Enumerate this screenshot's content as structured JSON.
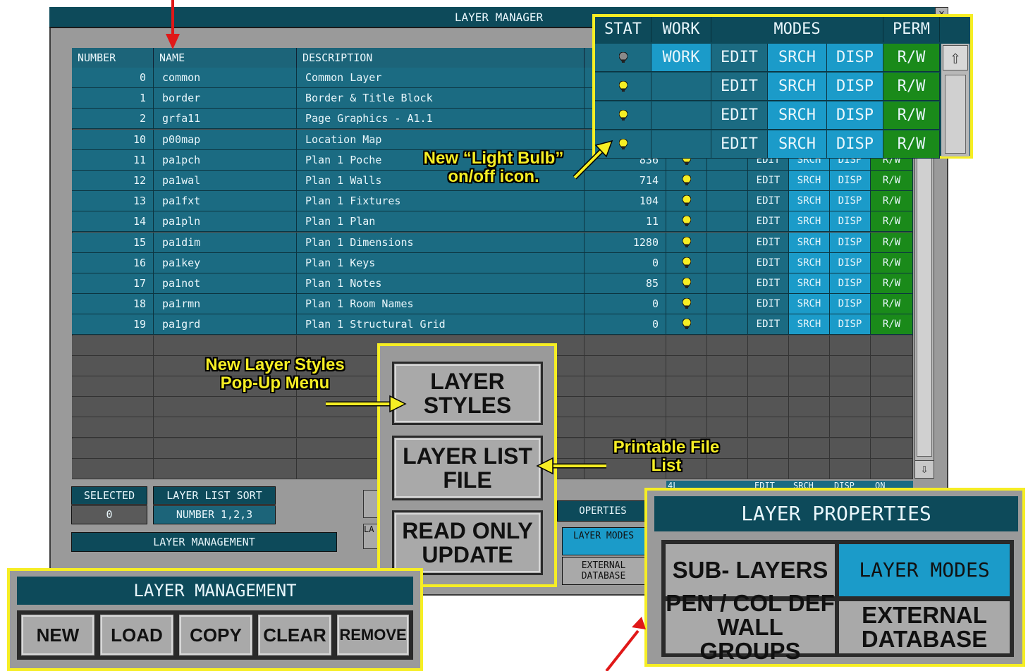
{
  "window": {
    "title": "LAYER MANAGER",
    "close_glyph": "✕"
  },
  "table": {
    "headers": {
      "number": "NUMBER",
      "name": "NAME",
      "description": "DESCRIPTION"
    },
    "rows": [
      {
        "number": "0",
        "name": "common",
        "description": "Common Layer",
        "count": "",
        "bulb": "off",
        "work": "WORK"
      },
      {
        "number": "1",
        "name": "border",
        "description": "Border & Title Block",
        "count": "",
        "bulb": "on",
        "work": ""
      },
      {
        "number": "2",
        "name": "grfa11",
        "description": "Page Graphics - A1.1",
        "count": "",
        "bulb": "on",
        "work": ""
      },
      {
        "number": "10",
        "name": "p00map",
        "description": "Location Map",
        "count": "",
        "bulb": "on",
        "work": ""
      },
      {
        "number": "11",
        "name": "pa1pch",
        "description": "Plan 1 Poche",
        "count": "836",
        "bulb": "on",
        "work": ""
      },
      {
        "number": "12",
        "name": "pa1wal",
        "description": "Plan 1 Walls",
        "count": "714",
        "bulb": "on",
        "work": ""
      },
      {
        "number": "13",
        "name": "pa1fxt",
        "description": "Plan 1 Fixtures",
        "count": "104",
        "bulb": "on",
        "work": ""
      },
      {
        "number": "14",
        "name": "pa1pln",
        "description": "Plan 1 Plan",
        "count": "11",
        "bulb": "on",
        "work": ""
      },
      {
        "number": "15",
        "name": "pa1dim",
        "description": "Plan 1 Dimensions",
        "count": "1280",
        "bulb": "on",
        "work": ""
      },
      {
        "number": "16",
        "name": "pa1key",
        "description": "Plan 1 Keys",
        "count": "0",
        "bulb": "on",
        "work": ""
      },
      {
        "number": "17",
        "name": "pa1not",
        "description": "Plan 1 Notes",
        "count": "85",
        "bulb": "on",
        "work": ""
      },
      {
        "number": "18",
        "name": "pa1rmn",
        "description": "Plan 1 Room Names",
        "count": "0",
        "bulb": "on",
        "work": ""
      },
      {
        "number": "19",
        "name": "pa1grd",
        "description": "Plan 1 Structural Grid",
        "count": "0",
        "bulb": "on",
        "work": ""
      }
    ],
    "modes": {
      "edit": "EDIT",
      "srch": "SRCH",
      "disp": "DISP",
      "perm": "R/W"
    },
    "partial_row": {
      "number": "4L",
      "edit": "EDIT",
      "srch": "SRCH",
      "disp": "DISP",
      "perm": "ON"
    }
  },
  "status_callout": {
    "headers": {
      "stat": "STAT",
      "work": "WORK",
      "modes": "MODES",
      "perm": "PERM"
    },
    "rows": [
      {
        "bulb": "off",
        "work": "WORK",
        "edit": "EDIT",
        "srch": "SRCH",
        "disp": "DISP",
        "perm": "R/W"
      },
      {
        "bulb": "on",
        "work": "",
        "edit": "EDIT",
        "srch": "SRCH",
        "disp": "DISP",
        "perm": "R/W"
      },
      {
        "bulb": "on",
        "work": "",
        "edit": "EDIT",
        "srch": "SRCH",
        "disp": "DISP",
        "perm": "R/W"
      },
      {
        "bulb": "on",
        "work": "",
        "edit": "EDIT",
        "srch": "SRCH",
        "disp": "DISP",
        "perm": "R/W"
      }
    ]
  },
  "selected": {
    "label": "SELECTED",
    "value": "0"
  },
  "sort": {
    "label": "LAYER LIST SORT",
    "value": "NUMBER 1,2,3"
  },
  "mgmt_small": {
    "title": "LAYER MANAGEMENT"
  },
  "properties_small": {
    "title": "OPERTIES",
    "layer_modes": "LAYER MODES",
    "external": "EXTERNAL DATABASE",
    "la": "LA"
  },
  "styles_menu": {
    "layer_styles": "LAYER STYLES",
    "layer_list_file": "LAYER LIST FILE",
    "read_only_update": "READ ONLY UPDATE"
  },
  "layer_management": {
    "title": "LAYER MANAGEMENT",
    "buttons": [
      "NEW",
      "LOAD",
      "COPY",
      "CLEAR",
      "REMOVE"
    ]
  },
  "layer_properties": {
    "title": "LAYER PROPERTIES",
    "sub_layers": "SUB- LAYERS",
    "layer_modes": "LAYER MODES",
    "pen_col": "PEN / COL DEF WALL GROUPS",
    "external_db": "EXTERNAL DATABASE"
  },
  "annotations": {
    "bulb": "New “Light Bulb” on/off icon.",
    "styles": "New Layer Styles Pop-Up Menu",
    "printable": "Printable File List"
  },
  "colors": {
    "accent": "#1c6479",
    "highlight": "#f6ee24",
    "mode_blue": "#1b9bc9",
    "perm_green": "#1a8a1a",
    "arrow_red": "#e01818"
  }
}
